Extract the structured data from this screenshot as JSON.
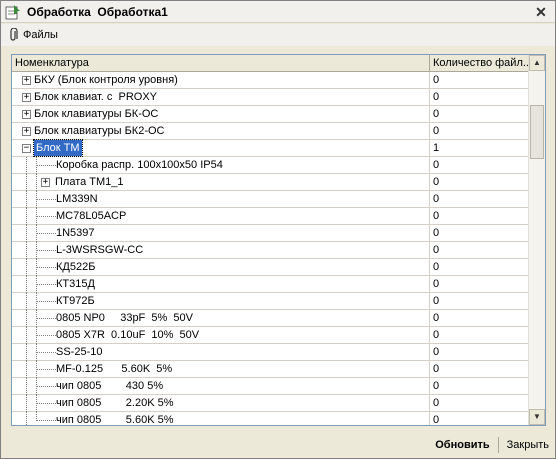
{
  "window": {
    "title": "Обработка  Обработка1",
    "close_glyph": "✕"
  },
  "menu": {
    "files_label": "Файлы"
  },
  "grid": {
    "columns": [
      "Номенклатура",
      "Количество файл..."
    ],
    "rows": [
      {
        "label": "БКУ (Блок контроля уровня)",
        "count": "0",
        "depth": 0,
        "expander": "+",
        "selected": false
      },
      {
        "label": "Блок клавиат. с  PROXY",
        "count": "0",
        "depth": 0,
        "expander": "+",
        "selected": false
      },
      {
        "label": "Блок клавиатуры БК-ОС",
        "count": "0",
        "depth": 0,
        "expander": "+",
        "selected": false
      },
      {
        "label": "Блок клавиатуры БК2-ОС",
        "count": "0",
        "depth": 0,
        "expander": "+",
        "selected": false
      },
      {
        "label": "Блок ТМ",
        "count": "1",
        "depth": 0,
        "expander": "−",
        "selected": true
      },
      {
        "label": "Коробка распр. 100х100х50 IP54",
        "count": "0",
        "depth": 1,
        "expander": "",
        "selected": false
      },
      {
        "label": "Плата ТМ1_1",
        "count": "0",
        "depth": 1,
        "expander": "+",
        "selected": false
      },
      {
        "label": "LM339N",
        "count": "0",
        "depth": 1,
        "expander": "",
        "selected": false
      },
      {
        "label": "MC78L05ACP",
        "count": "0",
        "depth": 1,
        "expander": "",
        "selected": false
      },
      {
        "label": "1N5397",
        "count": "0",
        "depth": 1,
        "expander": "",
        "selected": false
      },
      {
        "label": "L-3WSRSGW-CC",
        "count": "0",
        "depth": 1,
        "expander": "",
        "selected": false
      },
      {
        "label": "КД522Б",
        "count": "0",
        "depth": 1,
        "expander": "",
        "selected": false
      },
      {
        "label": "КТ315Д",
        "count": "0",
        "depth": 1,
        "expander": "",
        "selected": false
      },
      {
        "label": "КТ972Б",
        "count": "0",
        "depth": 1,
        "expander": "",
        "selected": false
      },
      {
        "label": "0805 NP0     33pF  5%  50V",
        "count": "0",
        "depth": 1,
        "expander": "",
        "selected": false
      },
      {
        "label": "0805 X7R  0.10uF  10%  50V",
        "count": "0",
        "depth": 1,
        "expander": "",
        "selected": false
      },
      {
        "label": "SS-25-10",
        "count": "0",
        "depth": 1,
        "expander": "",
        "selected": false
      },
      {
        "label": "MF-0.125      5.60K  5%",
        "count": "0",
        "depth": 1,
        "expander": "",
        "selected": false
      },
      {
        "label": "чип 0805        430 5%",
        "count": "0",
        "depth": 1,
        "expander": "",
        "selected": false
      },
      {
        "label": "чип 0805        2.20K 5%",
        "count": "0",
        "depth": 1,
        "expander": "",
        "selected": false
      },
      {
        "label": "чип 0805        5.60K 5%",
        "count": "0",
        "depth": 1,
        "expander": "",
        "selected": false
      }
    ]
  },
  "scrollbar": {
    "up_glyph": "▲",
    "down_glyph": "▼",
    "position_fraction": 0.12,
    "visible_fraction": 0.16
  },
  "footer": {
    "refresh_label": "Обновить",
    "close_label": "Закрыть"
  }
}
